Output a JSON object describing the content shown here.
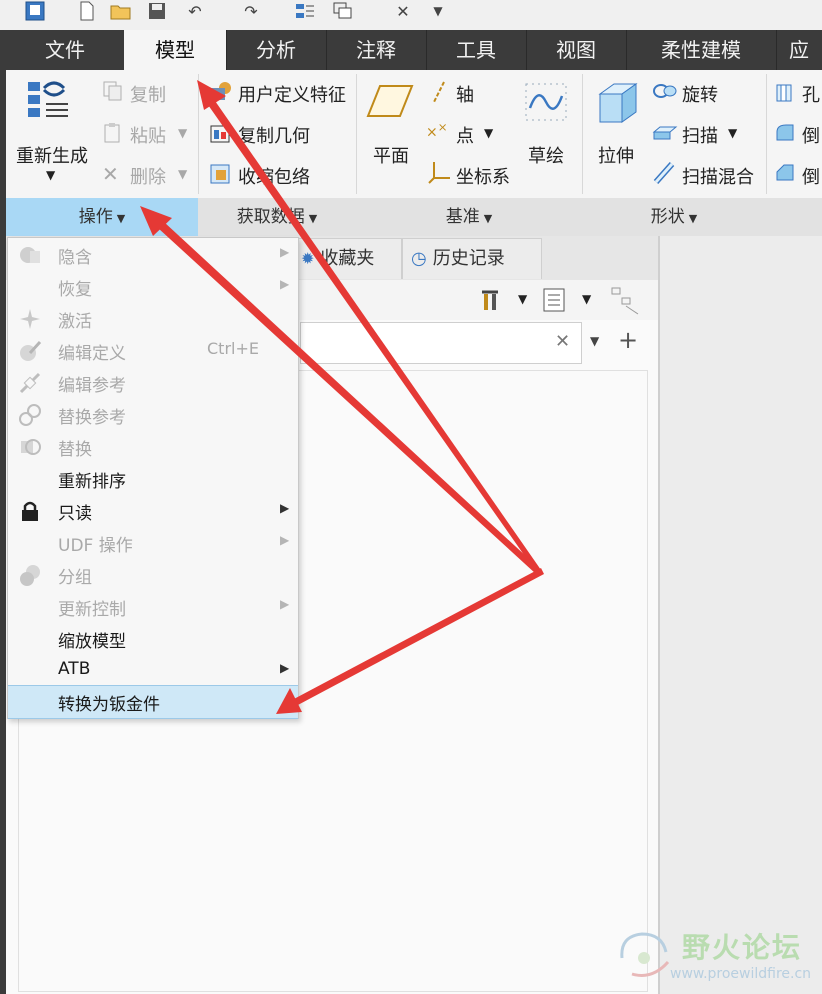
{
  "tabs": [
    {
      "label": "文件",
      "active": false
    },
    {
      "label": "模型",
      "active": true
    },
    {
      "label": "分析",
      "active": false
    },
    {
      "label": "注释",
      "active": false
    },
    {
      "label": "工具",
      "active": false
    },
    {
      "label": "视图",
      "active": false
    },
    {
      "label": "柔性建模",
      "active": false
    },
    {
      "label": "应",
      "active": false
    }
  ],
  "ribbon": {
    "regenerate": "重新生成",
    "copy": "复制",
    "paste": "粘贴",
    "delete": "删除",
    "udf": "用户定义特征",
    "copy_geometry": "复制几何",
    "shrinkwrap": "收缩包络",
    "plane": "平面",
    "axis": "轴",
    "point": "点",
    "csys": "坐标系",
    "sketch": "草绘",
    "extrude": "拉伸",
    "revolve": "旋转",
    "sweep": "扫描",
    "swept_blend": "扫描混合",
    "hole": "孔",
    "round": "倒",
    "chamfer": "倒"
  },
  "groups": [
    {
      "label": "操作",
      "active": true
    },
    {
      "label": "获取数据",
      "active": false
    },
    {
      "label": "基准",
      "active": false
    },
    {
      "label": "形状",
      "active": false
    }
  ],
  "panel": {
    "favorites_tab": "收藏夹",
    "history_tab": "历史记录"
  },
  "menu": {
    "items": [
      {
        "label": "隐含",
        "enabled": false,
        "submenu": true,
        "shortcut": "",
        "icon": "suppress-icon"
      },
      {
        "label": "恢复",
        "enabled": false,
        "submenu": true,
        "shortcut": "",
        "icon": ""
      },
      {
        "label": "激活",
        "enabled": false,
        "submenu": false,
        "shortcut": "",
        "icon": "activate-icon"
      },
      {
        "label": "编辑定义",
        "enabled": false,
        "submenu": false,
        "shortcut": "Ctrl+E",
        "icon": "edit-definition-icon"
      },
      {
        "label": "编辑参考",
        "enabled": false,
        "submenu": false,
        "shortcut": "",
        "icon": "edit-references-icon"
      },
      {
        "label": "替换参考",
        "enabled": false,
        "submenu": false,
        "shortcut": "",
        "icon": "replace-references-icon"
      },
      {
        "label": "替换",
        "enabled": false,
        "submenu": false,
        "shortcut": "",
        "icon": "replace-icon"
      },
      {
        "label": "重新排序",
        "enabled": true,
        "submenu": false,
        "shortcut": "",
        "icon": ""
      },
      {
        "label": "只读",
        "enabled": true,
        "submenu": true,
        "shortcut": "",
        "icon": "lock-icon"
      },
      {
        "label": "UDF 操作",
        "enabled": false,
        "submenu": true,
        "shortcut": "",
        "icon": ""
      },
      {
        "label": "分组",
        "enabled": false,
        "submenu": false,
        "shortcut": "",
        "icon": "group-icon"
      },
      {
        "label": "更新控制",
        "enabled": false,
        "submenu": true,
        "shortcut": "",
        "icon": ""
      },
      {
        "label": "缩放模型",
        "enabled": true,
        "submenu": false,
        "shortcut": "",
        "icon": ""
      },
      {
        "label": "ATB",
        "enabled": true,
        "submenu": true,
        "shortcut": "",
        "icon": ""
      },
      {
        "label": "转换为钣金件",
        "enabled": true,
        "submenu": false,
        "shortcut": "",
        "icon": "",
        "highlighted": true
      }
    ]
  },
  "watermark": {
    "title": "野火论坛",
    "url": "www.proewildfire.cn"
  },
  "colors": {
    "tab_bar": "#3b3b3b",
    "active_group": "#a9d8f5",
    "menu_highlight": "#cfe8f7",
    "arrow": "#e53935"
  }
}
